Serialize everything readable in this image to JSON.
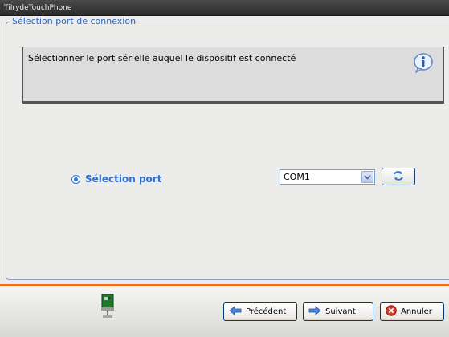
{
  "window": {
    "title": "TiIrydeTouchPhone"
  },
  "group": {
    "legend": "Sélection port de connexion"
  },
  "info": {
    "text": "Sélectionner le port sérielle auquel le dispositif est connecté",
    "icon": "info-icon"
  },
  "port": {
    "radio_label": "Sélection port",
    "selected": true,
    "combo_value": "COM1",
    "combo_icon": "chevron-down-icon",
    "refresh_icon": "refresh-icon"
  },
  "footer": {
    "status_icon": "network-card-icon",
    "buttons": {
      "prev_label": "Précédent",
      "next_label": "Suivant",
      "cancel_label": "Annuler"
    }
  },
  "colors": {
    "accent": "#2d6fd6",
    "separator": "#ee6a1c",
    "titlebar": "#2b2b2b"
  }
}
